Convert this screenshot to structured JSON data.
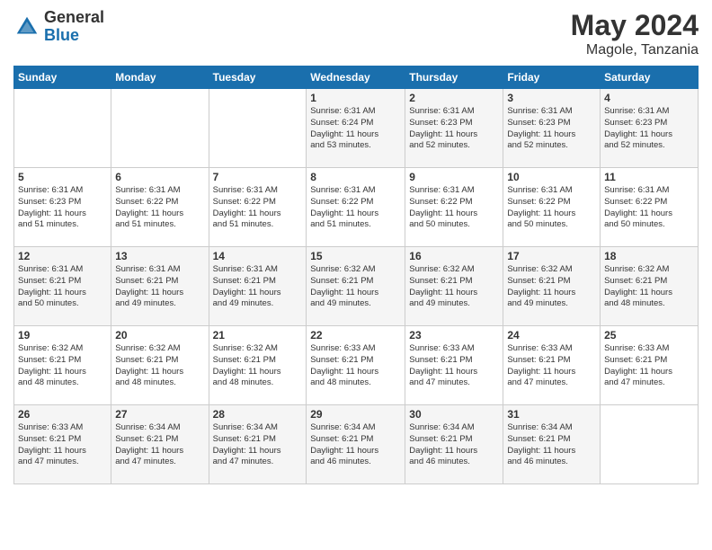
{
  "header": {
    "logo_general": "General",
    "logo_blue": "Blue",
    "month": "May 2024",
    "location": "Magole, Tanzania"
  },
  "days_of_week": [
    "Sunday",
    "Monday",
    "Tuesday",
    "Wednesday",
    "Thursday",
    "Friday",
    "Saturday"
  ],
  "weeks": [
    [
      {
        "day": "",
        "info": ""
      },
      {
        "day": "",
        "info": ""
      },
      {
        "day": "",
        "info": ""
      },
      {
        "day": "1",
        "info": "Sunrise: 6:31 AM\nSunset: 6:24 PM\nDaylight: 11 hours\nand 53 minutes."
      },
      {
        "day": "2",
        "info": "Sunrise: 6:31 AM\nSunset: 6:23 PM\nDaylight: 11 hours\nand 52 minutes."
      },
      {
        "day": "3",
        "info": "Sunrise: 6:31 AM\nSunset: 6:23 PM\nDaylight: 11 hours\nand 52 minutes."
      },
      {
        "day": "4",
        "info": "Sunrise: 6:31 AM\nSunset: 6:23 PM\nDaylight: 11 hours\nand 52 minutes."
      }
    ],
    [
      {
        "day": "5",
        "info": "Sunrise: 6:31 AM\nSunset: 6:23 PM\nDaylight: 11 hours\nand 51 minutes."
      },
      {
        "day": "6",
        "info": "Sunrise: 6:31 AM\nSunset: 6:22 PM\nDaylight: 11 hours\nand 51 minutes."
      },
      {
        "day": "7",
        "info": "Sunrise: 6:31 AM\nSunset: 6:22 PM\nDaylight: 11 hours\nand 51 minutes."
      },
      {
        "day": "8",
        "info": "Sunrise: 6:31 AM\nSunset: 6:22 PM\nDaylight: 11 hours\nand 51 minutes."
      },
      {
        "day": "9",
        "info": "Sunrise: 6:31 AM\nSunset: 6:22 PM\nDaylight: 11 hours\nand 50 minutes."
      },
      {
        "day": "10",
        "info": "Sunrise: 6:31 AM\nSunset: 6:22 PM\nDaylight: 11 hours\nand 50 minutes."
      },
      {
        "day": "11",
        "info": "Sunrise: 6:31 AM\nSunset: 6:22 PM\nDaylight: 11 hours\nand 50 minutes."
      }
    ],
    [
      {
        "day": "12",
        "info": "Sunrise: 6:31 AM\nSunset: 6:21 PM\nDaylight: 11 hours\nand 50 minutes."
      },
      {
        "day": "13",
        "info": "Sunrise: 6:31 AM\nSunset: 6:21 PM\nDaylight: 11 hours\nand 49 minutes."
      },
      {
        "day": "14",
        "info": "Sunrise: 6:31 AM\nSunset: 6:21 PM\nDaylight: 11 hours\nand 49 minutes."
      },
      {
        "day": "15",
        "info": "Sunrise: 6:32 AM\nSunset: 6:21 PM\nDaylight: 11 hours\nand 49 minutes."
      },
      {
        "day": "16",
        "info": "Sunrise: 6:32 AM\nSunset: 6:21 PM\nDaylight: 11 hours\nand 49 minutes."
      },
      {
        "day": "17",
        "info": "Sunrise: 6:32 AM\nSunset: 6:21 PM\nDaylight: 11 hours\nand 49 minutes."
      },
      {
        "day": "18",
        "info": "Sunrise: 6:32 AM\nSunset: 6:21 PM\nDaylight: 11 hours\nand 48 minutes."
      }
    ],
    [
      {
        "day": "19",
        "info": "Sunrise: 6:32 AM\nSunset: 6:21 PM\nDaylight: 11 hours\nand 48 minutes."
      },
      {
        "day": "20",
        "info": "Sunrise: 6:32 AM\nSunset: 6:21 PM\nDaylight: 11 hours\nand 48 minutes."
      },
      {
        "day": "21",
        "info": "Sunrise: 6:32 AM\nSunset: 6:21 PM\nDaylight: 11 hours\nand 48 minutes."
      },
      {
        "day": "22",
        "info": "Sunrise: 6:33 AM\nSunset: 6:21 PM\nDaylight: 11 hours\nand 48 minutes."
      },
      {
        "day": "23",
        "info": "Sunrise: 6:33 AM\nSunset: 6:21 PM\nDaylight: 11 hours\nand 47 minutes."
      },
      {
        "day": "24",
        "info": "Sunrise: 6:33 AM\nSunset: 6:21 PM\nDaylight: 11 hours\nand 47 minutes."
      },
      {
        "day": "25",
        "info": "Sunrise: 6:33 AM\nSunset: 6:21 PM\nDaylight: 11 hours\nand 47 minutes."
      }
    ],
    [
      {
        "day": "26",
        "info": "Sunrise: 6:33 AM\nSunset: 6:21 PM\nDaylight: 11 hours\nand 47 minutes."
      },
      {
        "day": "27",
        "info": "Sunrise: 6:34 AM\nSunset: 6:21 PM\nDaylight: 11 hours\nand 47 minutes."
      },
      {
        "day": "28",
        "info": "Sunrise: 6:34 AM\nSunset: 6:21 PM\nDaylight: 11 hours\nand 47 minutes."
      },
      {
        "day": "29",
        "info": "Sunrise: 6:34 AM\nSunset: 6:21 PM\nDaylight: 11 hours\nand 46 minutes."
      },
      {
        "day": "30",
        "info": "Sunrise: 6:34 AM\nSunset: 6:21 PM\nDaylight: 11 hours\nand 46 minutes."
      },
      {
        "day": "31",
        "info": "Sunrise: 6:34 AM\nSunset: 6:21 PM\nDaylight: 11 hours\nand 46 minutes."
      },
      {
        "day": "",
        "info": ""
      }
    ]
  ]
}
